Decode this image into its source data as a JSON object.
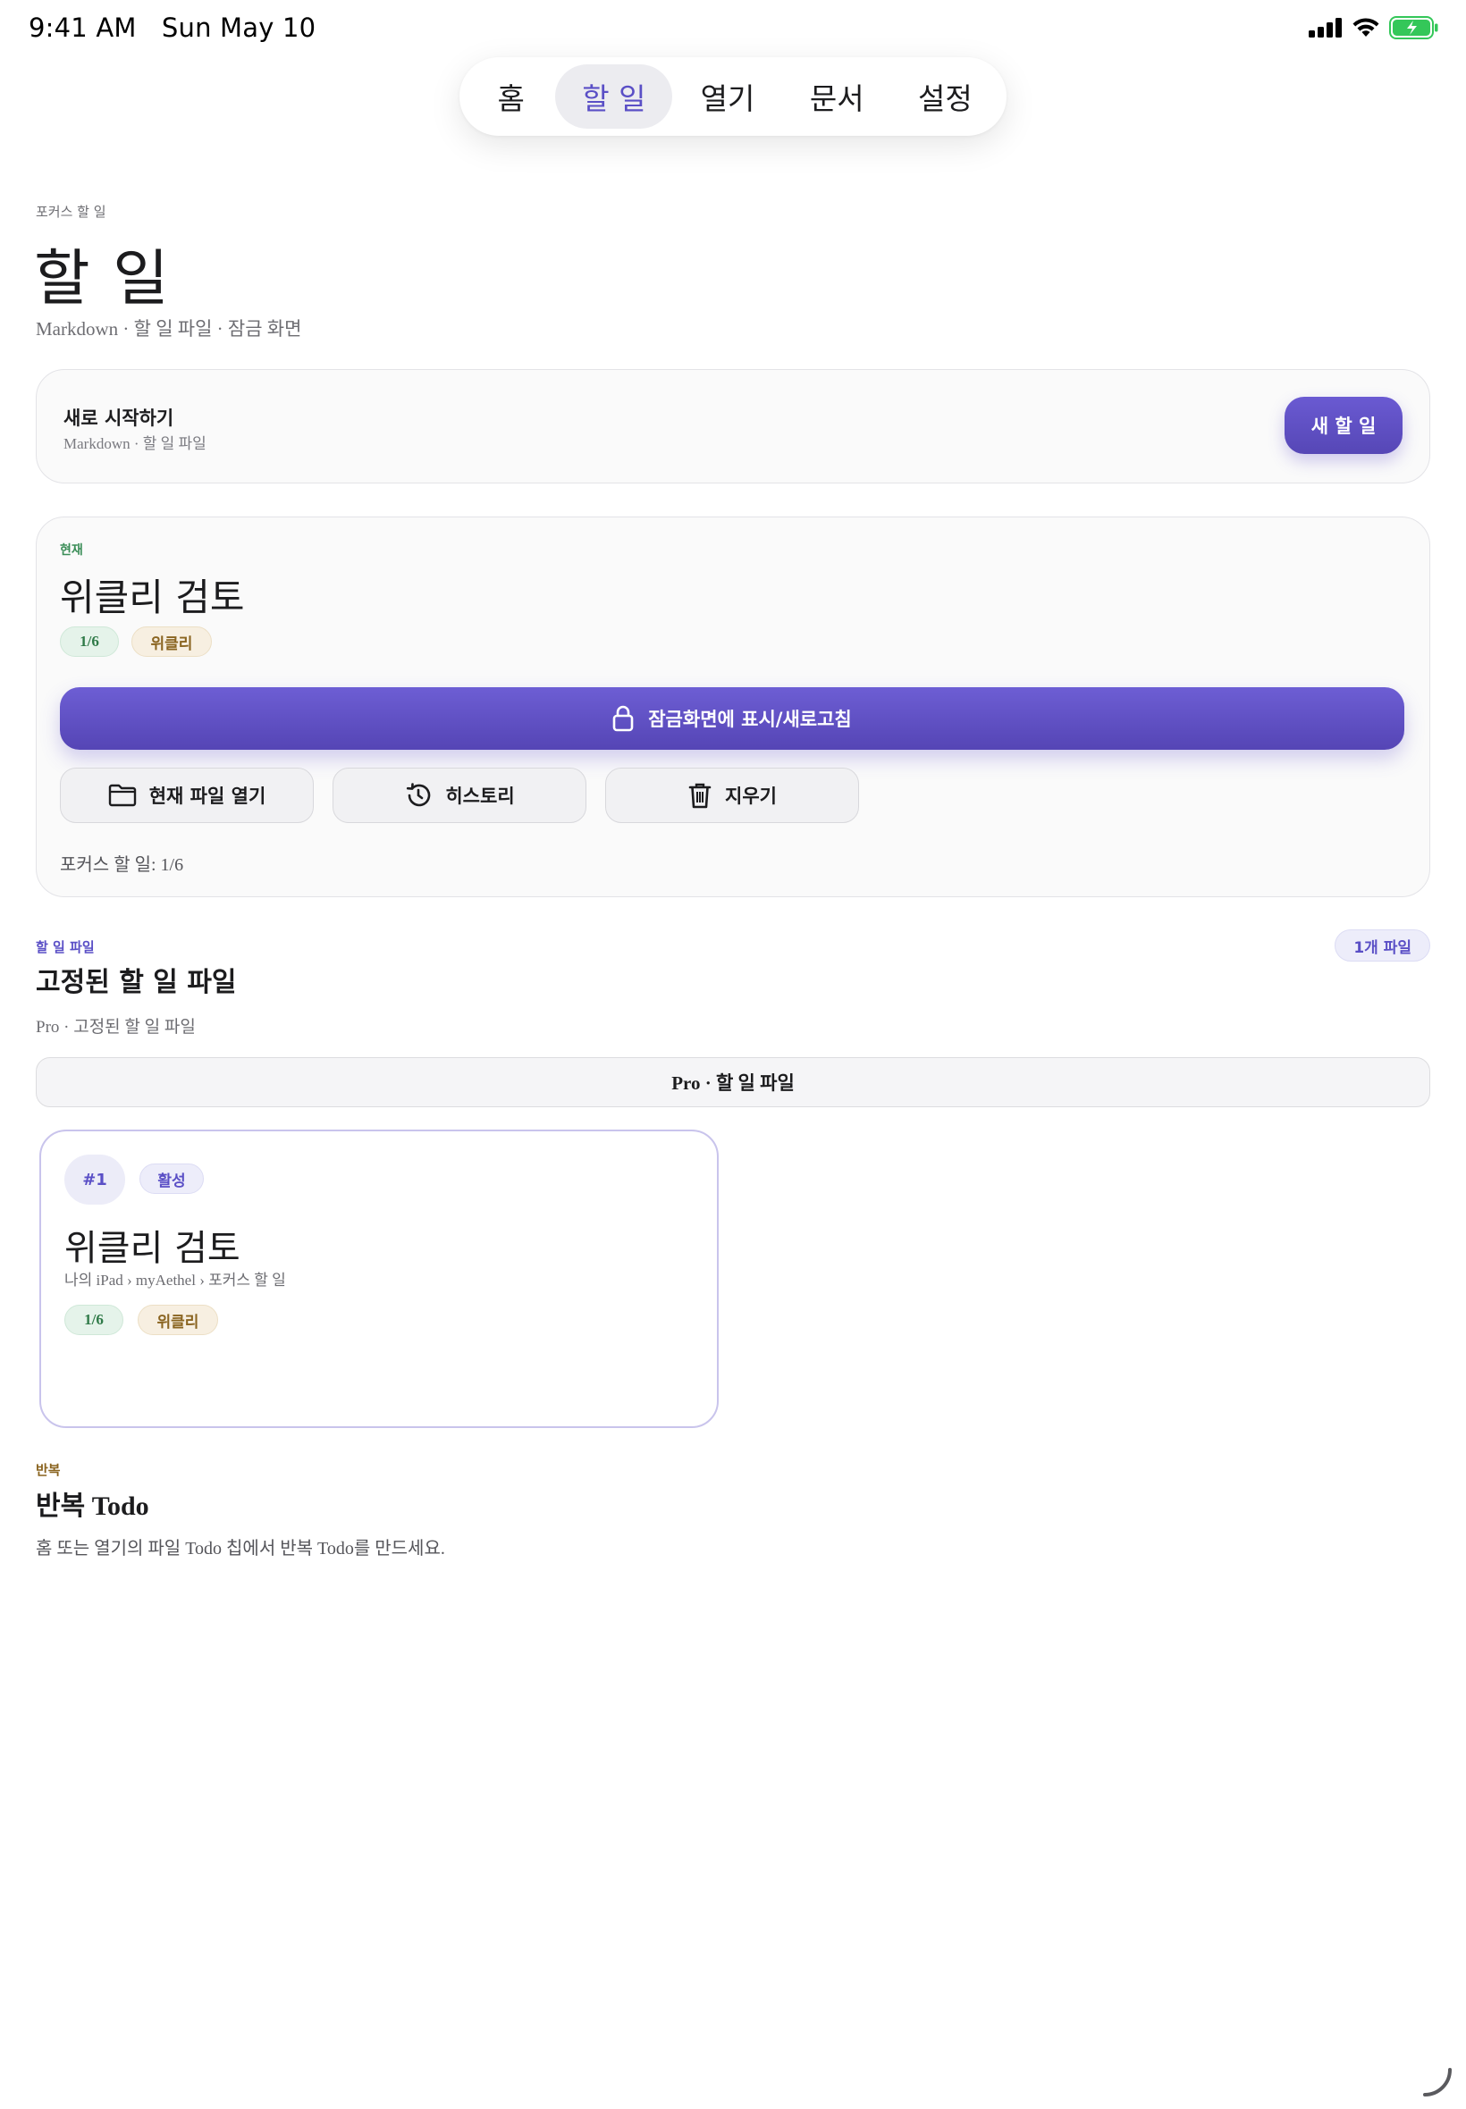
{
  "status": {
    "time": "9:41 AM",
    "date": "Sun May 10"
  },
  "tabs": [
    {
      "label": "홈",
      "active": false
    },
    {
      "label": "할 일",
      "active": true
    },
    {
      "label": "열기",
      "active": false
    },
    {
      "label": "문서",
      "active": false
    },
    {
      "label": "설정",
      "active": false
    }
  ],
  "header": {
    "eyebrow": "포커스 할 일",
    "title": "할 일",
    "subtitle": "Markdown · 할 일 파일 · 잠금 화면"
  },
  "start_card": {
    "title": "새로 시작하기",
    "subtitle": "Markdown · 할 일 파일",
    "new_button": "새 할 일"
  },
  "current_card": {
    "tag": "현재",
    "title": "위클리 검토",
    "progress_pill": "1/6",
    "category_pill": "위클리",
    "lock_button": "잠금화면에 표시/새로고침",
    "open_button": "현재 파일 열기",
    "history_button": "히스토리",
    "clear_button": "지우기",
    "focus_status": "포커스 할 일: 1/6"
  },
  "pinned_section": {
    "eyebrow": "할 일 파일",
    "title": "고정된 할 일 파일",
    "description": "Pro · 고정된 할 일 파일",
    "count_badge": "1개 파일",
    "pro_bar": "Pro · 할 일 파일",
    "file_card": {
      "number": "#1",
      "status": "활성",
      "title": "위클리 검토",
      "path": "나의 iPad › myAethel › 포커스 할 일",
      "progress_pill": "1/6",
      "category_pill": "위클리"
    }
  },
  "repeat_section": {
    "eyebrow": "반복",
    "title": "반복 Todo",
    "description": "홈 또는 열기의 파일 Todo 칩에서 반복 Todo를 만드세요."
  },
  "colors": {
    "accent": "#5a4fc6",
    "accent_button": "#5e4fc0",
    "green_tag": "#3a8d57",
    "tan_tag": "#8a6420"
  }
}
